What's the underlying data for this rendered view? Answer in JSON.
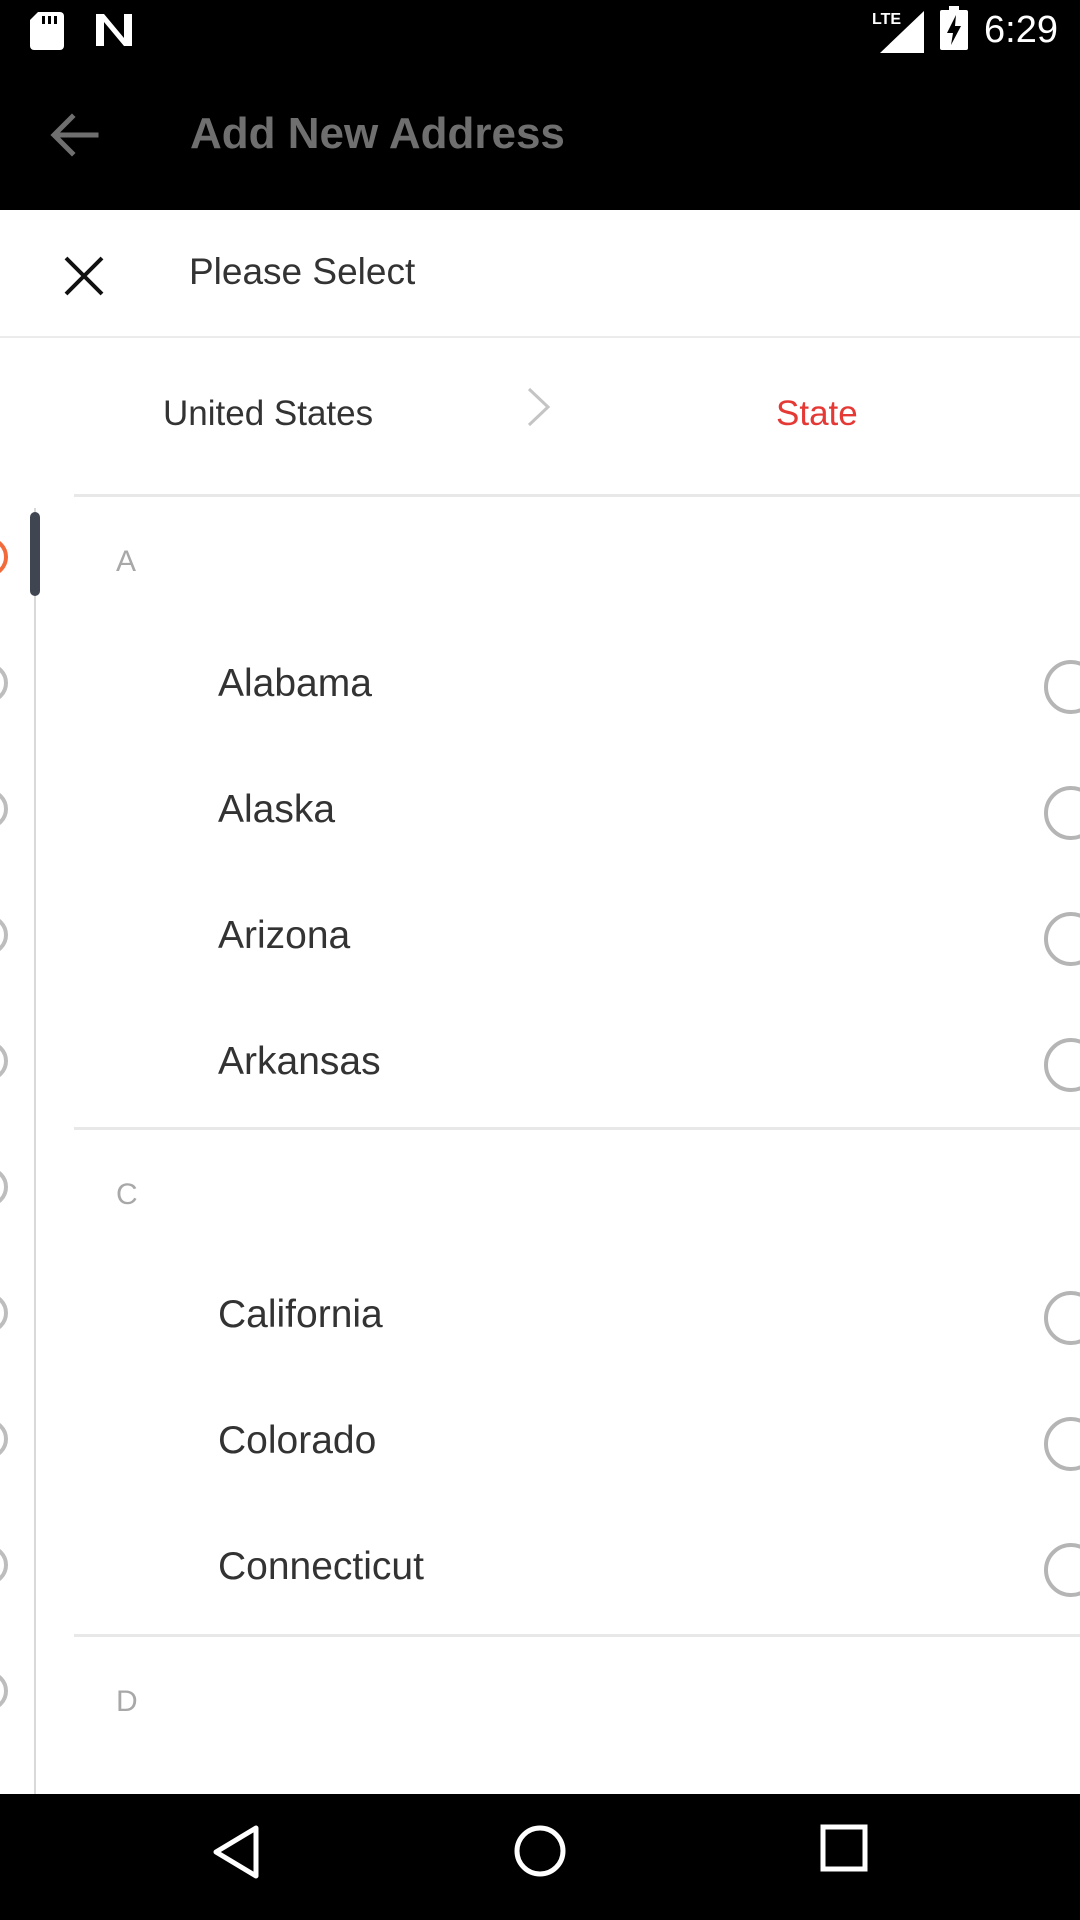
{
  "status_bar": {
    "time": "6:29",
    "network": "LTE",
    "icons": [
      "sd-card-icon",
      "n-notification-icon",
      "signal-icon",
      "battery-charging-icon"
    ]
  },
  "app_bar": {
    "title": "Add New Address",
    "back_icon": "arrow-back-icon"
  },
  "sheet": {
    "title": "Please Select",
    "close_icon": "close-icon",
    "breadcrumbs": {
      "country": "United States",
      "separator_icon": "chevron-right-icon",
      "current": "State"
    },
    "sections": [
      {
        "letter": "A",
        "states": [
          "Alabama",
          "Alaska",
          "Arizona",
          "Arkansas"
        ]
      },
      {
        "letter": "C",
        "states": [
          "California",
          "Colorado",
          "Connecticut"
        ]
      },
      {
        "letter": "D",
        "states": []
      }
    ]
  },
  "colors": {
    "accent": "#e53935",
    "rail_active": "#f26b3a",
    "app_bar_bg": "#000000",
    "title_gray": "#6f6f6f"
  },
  "nav_bar": {
    "icons": [
      "back-triangle-icon",
      "home-circle-icon",
      "recents-square-icon"
    ]
  }
}
